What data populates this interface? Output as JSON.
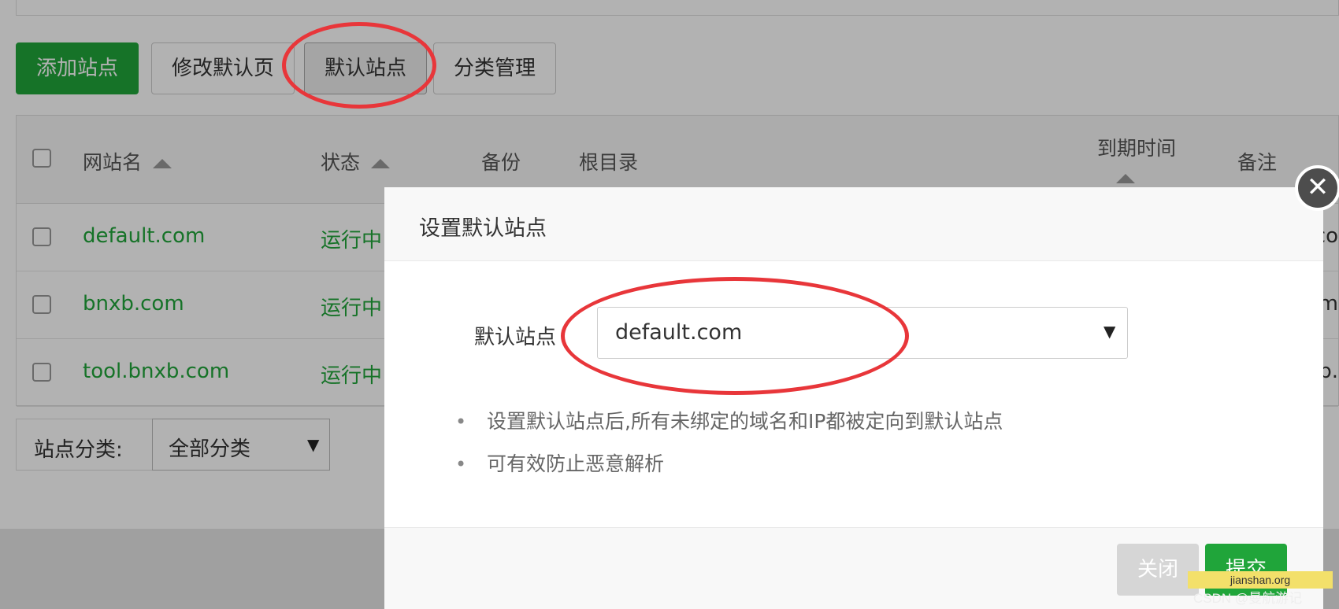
{
  "toolbar": {
    "add_site": "添加站点",
    "edit_default_page": "修改默认页",
    "default_site": "默认站点",
    "category_manage": "分类管理"
  },
  "table": {
    "headers": {
      "site_name": "网站名",
      "status": "状态",
      "backup": "备份",
      "root_dir": "根目录",
      "expire_time": "到期时间",
      "remark": "备注"
    },
    "rows": [
      {
        "name": "default.com",
        "status": "运行中",
        "tail": "co"
      },
      {
        "name": "bnxb.com",
        "status": "运行中",
        "tail": "m"
      },
      {
        "name": "tool.bnxb.com",
        "status": "运行中",
        "tail": "b."
      }
    ]
  },
  "filter": {
    "label": "站点分类:",
    "value": "全部分类"
  },
  "modal": {
    "title": "设置默认站点",
    "field_label": "默认站点",
    "selected_site": "default.com",
    "notes": [
      "设置默认站点后,所有未绑定的域名和IP都被定向到默认站点",
      "可有效防止恶意解析"
    ],
    "close_label": "关闭",
    "submit_label": "提交"
  },
  "watermark": {
    "site": "jianshan.org",
    "credit": "CSDN @曼航游记"
  },
  "colors": {
    "accent_green": "#20a53a",
    "annotation_red": "#e8363a"
  }
}
